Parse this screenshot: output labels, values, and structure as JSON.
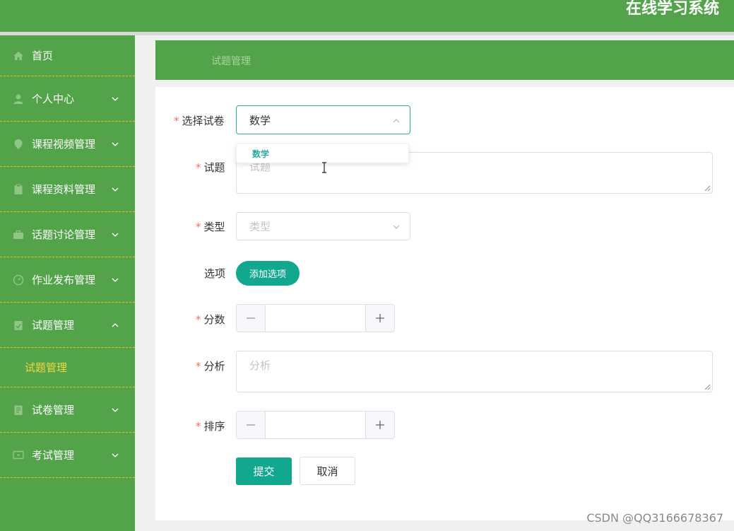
{
  "header": {
    "title": "在线学习系统"
  },
  "sidebar": {
    "items": [
      {
        "label": "首页",
        "icon": "home-icon"
      },
      {
        "label": "个人中心",
        "icon": "user-icon"
      },
      {
        "label": "课程视频管理",
        "icon": "location-icon"
      },
      {
        "label": "课程资料管理",
        "icon": "clipboard-icon"
      },
      {
        "label": "话题讨论管理",
        "icon": "briefcase-icon"
      },
      {
        "label": "作业发布管理",
        "icon": "dashboard-icon"
      },
      {
        "label": "试题管理",
        "icon": "document-check-icon"
      },
      {
        "label": "试卷管理",
        "icon": "notebook-icon"
      },
      {
        "label": "考试管理",
        "icon": "monitor-icon"
      }
    ],
    "submenu": {
      "label": "试题管理"
    }
  },
  "breadcrumb": {
    "text": "试题管理"
  },
  "form": {
    "paper": {
      "label": "选择试卷",
      "value": "数学",
      "options": [
        "数学"
      ]
    },
    "question": {
      "label": "试题",
      "placeholder": "试题"
    },
    "type": {
      "label": "类型",
      "placeholder": "类型"
    },
    "options": {
      "label": "选项",
      "add_label": "添加选项"
    },
    "score": {
      "label": "分数",
      "value": ""
    },
    "analysis": {
      "label": "分析",
      "placeholder": "分析"
    },
    "order": {
      "label": "排序",
      "value": ""
    },
    "submit_label": "提交",
    "cancel_label": "取消"
  },
  "watermark": "CSDN @QQ3166678367",
  "colors": {
    "green": "#53a34b",
    "teal": "#12a88f",
    "gold": "#e6c421",
    "required": "#f56c6c"
  }
}
